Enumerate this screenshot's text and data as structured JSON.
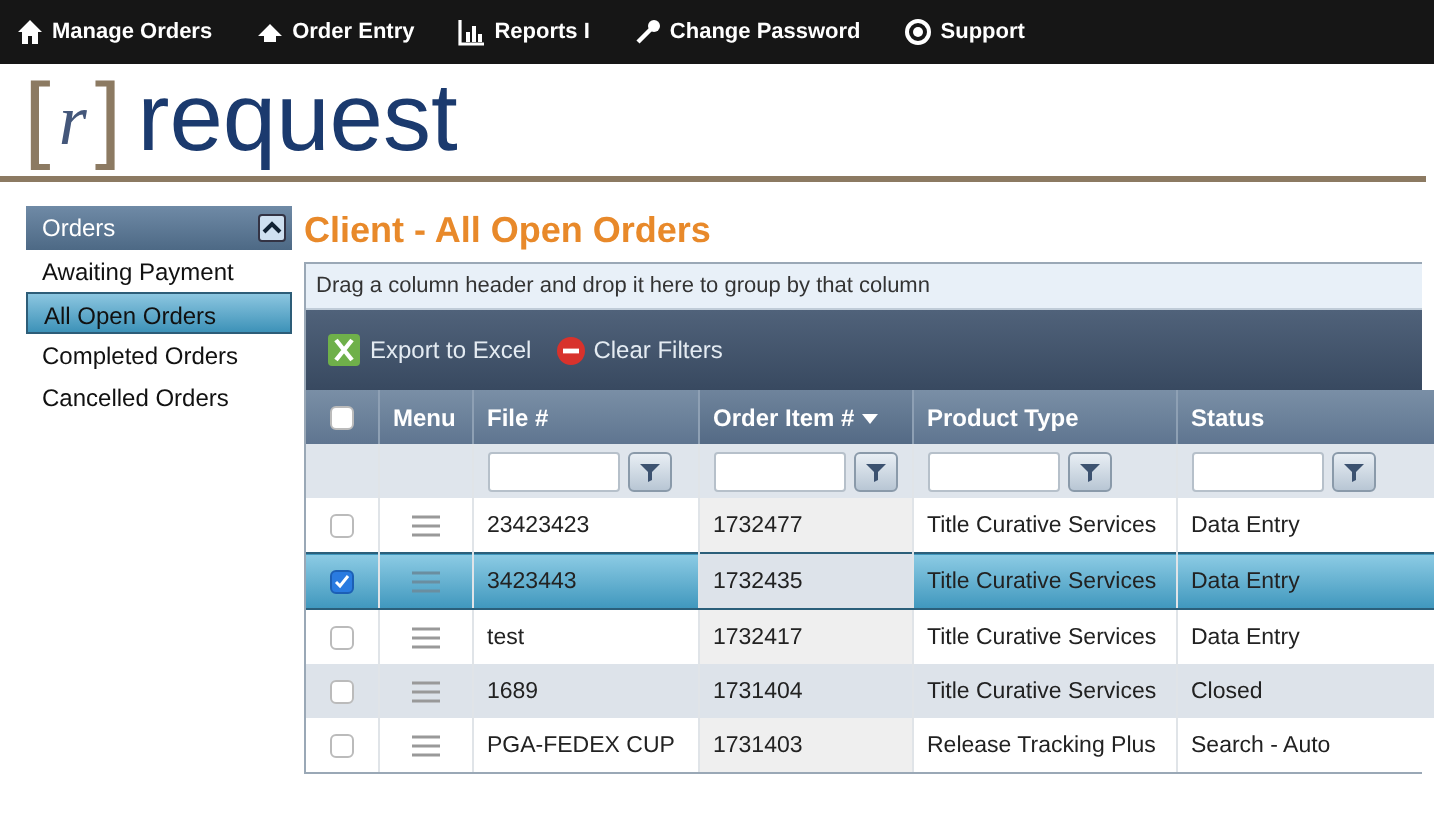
{
  "nav": [
    {
      "label": "Manage Orders"
    },
    {
      "label": "Order Entry"
    },
    {
      "label": "Reports I"
    },
    {
      "label": "Change Password"
    },
    {
      "label": "Support"
    }
  ],
  "logo": {
    "bracket_left": "[",
    "letter": "r",
    "bracket_right": "]",
    "word": "request"
  },
  "sidebar": {
    "title": "Orders",
    "expanded": true,
    "items": [
      {
        "label": "Awaiting Payment",
        "selected": false
      },
      {
        "label": "All Open Orders",
        "selected": true
      },
      {
        "label": "Completed Orders",
        "selected": false
      },
      {
        "label": "Cancelled Orders",
        "selected": false
      }
    ]
  },
  "page_title": "Client - All Open Orders",
  "group_hint": "Drag a column header and drop it here to group by that column",
  "toolbar": [
    {
      "label": "Export to Excel"
    },
    {
      "label": "Clear Filters"
    }
  ],
  "table": {
    "select_all_checked": false,
    "menu_header": "Menu",
    "columns": [
      {
        "label": "File #",
        "filter": true,
        "sorted": false
      },
      {
        "label": "Order Item #",
        "filter": true,
        "sorted": true
      },
      {
        "label": "Product Type",
        "filter": true,
        "sorted": false
      },
      {
        "label": "Status",
        "filter": true,
        "sorted": false
      }
    ],
    "rows": [
      {
        "selected": false,
        "cells": [
          "23423423",
          "1732477",
          "Title Curative Services",
          "Data Entry"
        ]
      },
      {
        "selected": true,
        "cells": [
          "3423443",
          "1732435",
          "Title Curative Services",
          "Data Entry"
        ]
      },
      {
        "selected": false,
        "cells": [
          "test",
          "1732417",
          "Title Curative Services",
          "Data Entry"
        ]
      },
      {
        "selected": false,
        "cells": [
          "1689",
          "1731404",
          "Title Curative Services",
          "Closed"
        ]
      },
      {
        "selected": false,
        "cells": [
          "PGA-FEDEX CUP",
          "1731403",
          "Release Tracking Plus",
          "Search - Auto"
        ]
      }
    ]
  }
}
